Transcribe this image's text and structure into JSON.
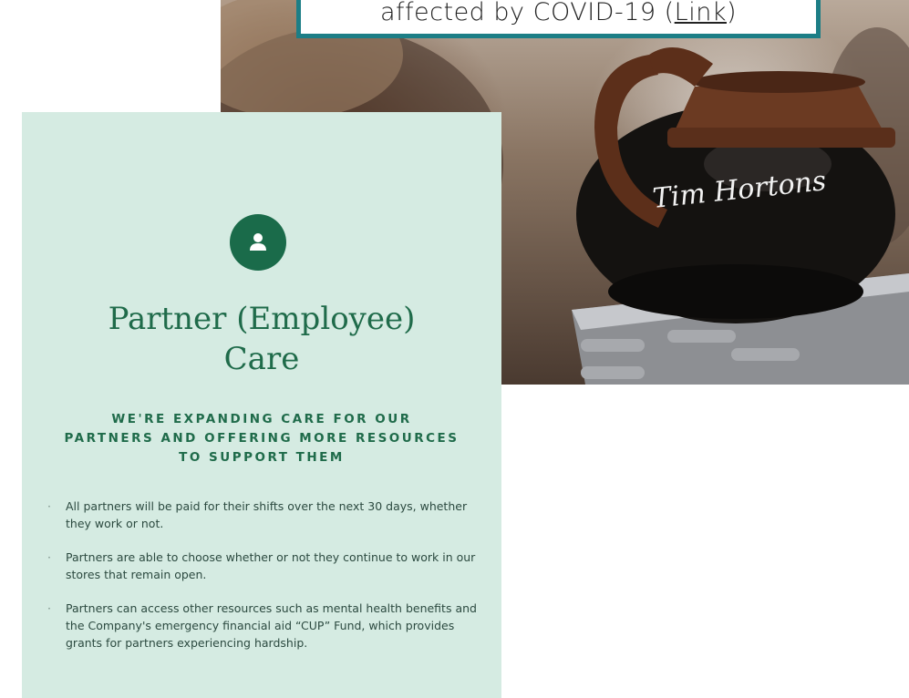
{
  "caption": {
    "text_before": "affected by COVID-19 (",
    "link_text": "Link",
    "text_after": ")",
    "border_color": "#1c7e86"
  },
  "photo": {
    "brand_text": "Tim Hortons"
  },
  "card": {
    "icon": "person-icon",
    "title_lines": [
      "Partner (Employee)",
      "Care"
    ],
    "subtitle_lines": [
      "WE'RE EXPANDING CARE FOR OUR",
      "PARTNERS AND OFFERING MORE RESOURCES",
      "TO SUPPORT THEM"
    ],
    "bullets": [
      "All partners will be paid for their shifts over the next 30 days, whether they work or not.",
      "Partners are able to choose whether or not they continue to work in our stores that remain open.",
      "Partners can access other resources such as mental health benefits and the Company's emergency financial aid “CUP” Fund, which provides grants for partners experiencing hardship."
    ],
    "background_color": "#d5ebe2",
    "accent_color": "#1f6b4a"
  }
}
